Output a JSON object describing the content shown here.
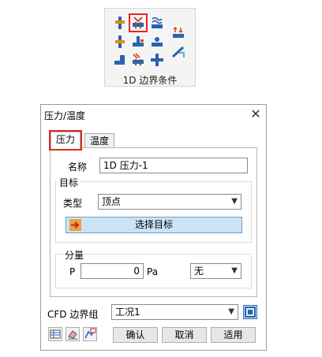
{
  "ribbon": {
    "title": "1D 边界条件",
    "icons": [
      "pipe-pressure-icon",
      "pipe-temperature-icon",
      "pipe-heat-icon",
      "flow-arrows-icon",
      "pipe-inlet-icon",
      "pipe-outlet-icon",
      "pipe-pump-icon",
      "pipe-valve-icon",
      "tank-icon",
      "pipe-heater-icon",
      "pipe-cross-icon",
      "pipe-slope-icon"
    ]
  },
  "dialog": {
    "title": "压力/温度",
    "close": "✕",
    "tabs": [
      "压力",
      "温度"
    ],
    "name_label": "名称",
    "name_value": "1D 压力-1",
    "target_group": "目标",
    "type_label": "类型",
    "type_value": "顶点",
    "select_target_button": "选择目标",
    "component_group": "分量",
    "p_label": "P",
    "p_value": "0",
    "p_unit": "Pa",
    "dir_value": "无",
    "cfd_label": "CFD 边界组",
    "cfd_value": "工况1",
    "ok_button": "确认",
    "cancel_button": "取消",
    "apply_button": "适用"
  },
  "colors": {
    "highlight": "#e02a20",
    "select_target_bg": "#cbe3f7",
    "icon_blue": "#2a63b0"
  }
}
